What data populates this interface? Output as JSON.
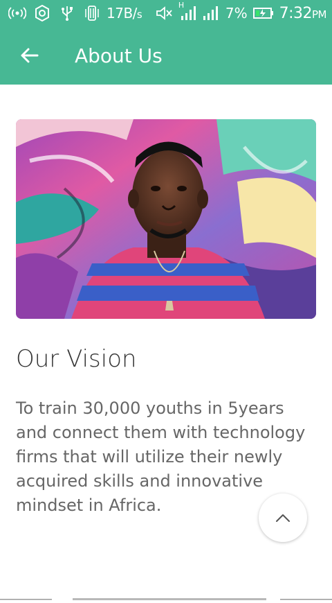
{
  "status_bar": {
    "net_speed": "17B/",
    "net_speed_unit": "s",
    "network_type": "H",
    "battery_percent": "7%",
    "time": "7:32",
    "time_suffix": "PM",
    "icons": [
      "wifi-hotspot-icon",
      "settings-icon",
      "usb-icon",
      "vibrate-icon",
      "mute-icon",
      "signal-icon",
      "signal-icon",
      "battery-icon"
    ]
  },
  "app_bar": {
    "title": "About Us",
    "back_icon": "arrow-left-icon",
    "color": "#47b894"
  },
  "content": {
    "heading": "Our Vision",
    "body": "To train 30,000 youths in 5years and connect them with technology firms that will utilize their newly acquired skills and innovative mindset in Africa."
  },
  "fab": {
    "icon": "chevron-up-icon"
  }
}
